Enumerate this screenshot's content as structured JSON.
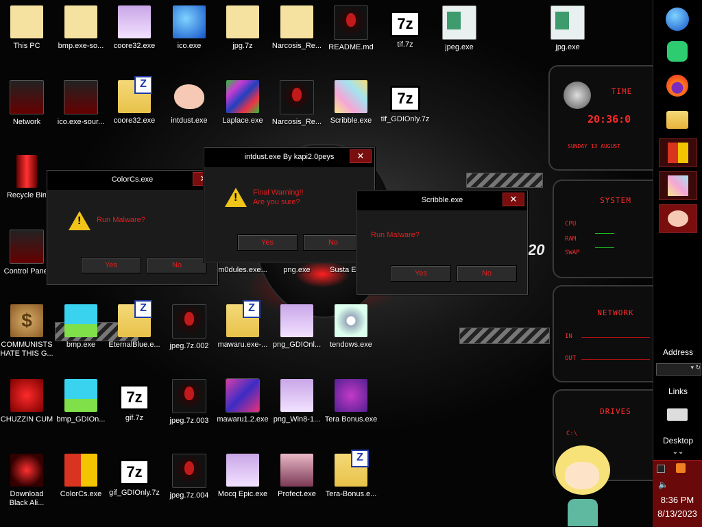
{
  "desktop": {
    "icons": [
      {
        "label": "This PC",
        "img": "face"
      },
      {
        "label": "bmp.exe-so...",
        "img": "face"
      },
      {
        "label": "coore32.exe",
        "img": "anime"
      },
      {
        "label": "ico.exe",
        "img": "globe"
      },
      {
        "label": "jpg.7z",
        "img": "face"
      },
      {
        "label": "Narcosis_Re...",
        "img": "face"
      },
      {
        "label": "README.md",
        "img": "alien"
      },
      {
        "label": "tif.7z",
        "img": "7z"
      },
      {
        "label": "jpeg.exe",
        "img": "doc"
      },
      {
        "label": "jpg.exe",
        "img": "doc"
      },
      {
        "label": "Network",
        "img": "cp"
      },
      {
        "label": "ico.exe-sour...",
        "img": "cp"
      },
      {
        "label": "coore32.exe",
        "img": "folder"
      },
      {
        "label": "intdust.exe",
        "img": "paint"
      },
      {
        "label": "Laplace.exe",
        "img": "noise"
      },
      {
        "label": "Narcosis_Re...",
        "img": "alien"
      },
      {
        "label": "Scribble.exe",
        "img": "pastel"
      },
      {
        "label": "tif_GDIOnly.7z",
        "img": "7z"
      },
      {
        "label": "Recycle Bin",
        "img": "trash"
      },
      {
        "label": "Control Panel",
        "img": "cp"
      },
      {
        "label": "m0dules.exe...",
        "img": "none"
      },
      {
        "label": "png.exe",
        "img": "none"
      },
      {
        "label": "Susta Epic...",
        "img": "none"
      },
      {
        "label": "COMMUNISTS HATE THIS G...",
        "img": "money"
      },
      {
        "label": "bmp.exe",
        "img": "picture"
      },
      {
        "label": "EternalBlue.e...",
        "img": "folder"
      },
      {
        "label": "jpeg.7z.002",
        "img": "alien"
      },
      {
        "label": "mawaru.exe-...",
        "img": "folder"
      },
      {
        "label": "png_GDIOnl...",
        "img": "anime"
      },
      {
        "label": "tendows.exe",
        "img": "cd"
      },
      {
        "label": "CHUZZIN CUM",
        "img": "red"
      },
      {
        "label": "bmp_GDIOn...",
        "img": "picture"
      },
      {
        "label": "gif.7z",
        "img": "7z"
      },
      {
        "label": "jpeg.7z.003",
        "img": "alien"
      },
      {
        "label": "mawaru1.2.exe",
        "img": "mawaru"
      },
      {
        "label": "png_Win8-1...",
        "img": "anime"
      },
      {
        "label": "Tera Bonus.exe",
        "img": "tera"
      },
      {
        "label": "Download Black Ali...",
        "img": "glow"
      },
      {
        "label": "ColorCs.exe",
        "img": "colorcs"
      },
      {
        "label": "gif_GDIOnly.7z",
        "img": "7z"
      },
      {
        "label": "jpeg.7z.004",
        "img": "alien"
      },
      {
        "label": "Mocq Epic.exe",
        "img": "anime"
      },
      {
        "label": "Profect.exe",
        "img": "profect"
      },
      {
        "label": "Tera-Bonus.e...",
        "img": "folder"
      }
    ],
    "wallpaper_text": "20"
  },
  "dialogs": {
    "colorcs": {
      "title": "ColorCs.exe",
      "message": "Run Malware?",
      "yes": "Yes",
      "no": "No"
    },
    "intdust": {
      "title": "intdust.exe By kapi2.0peys",
      "message_line1": "Final Warning!!",
      "message_line2": "Are you sure?",
      "yes": "Yes",
      "no": "No"
    },
    "scribble": {
      "title": "Scribble.exe",
      "message": "Run Malware?",
      "yes": "Yes",
      "no": "No"
    }
  },
  "widgets": {
    "time_title": "TIME",
    "time_value": "20:36:0",
    "date_value": "SUNDAY 13 AUGUST",
    "system_title": "SYSTEM",
    "cpu": "CPU",
    "ram": "RAM",
    "swap": "SWAP",
    "network_title": "NETWORK",
    "in": "IN",
    "out": "OUT",
    "drives_title": "DRIVES",
    "drive": "C:\\"
  },
  "taskbar": {
    "address": "Address",
    "links": "Links",
    "desktop": "Desktop",
    "time": "8:36 PM",
    "date": "8/13/2023",
    "accent": "#6a0909"
  }
}
